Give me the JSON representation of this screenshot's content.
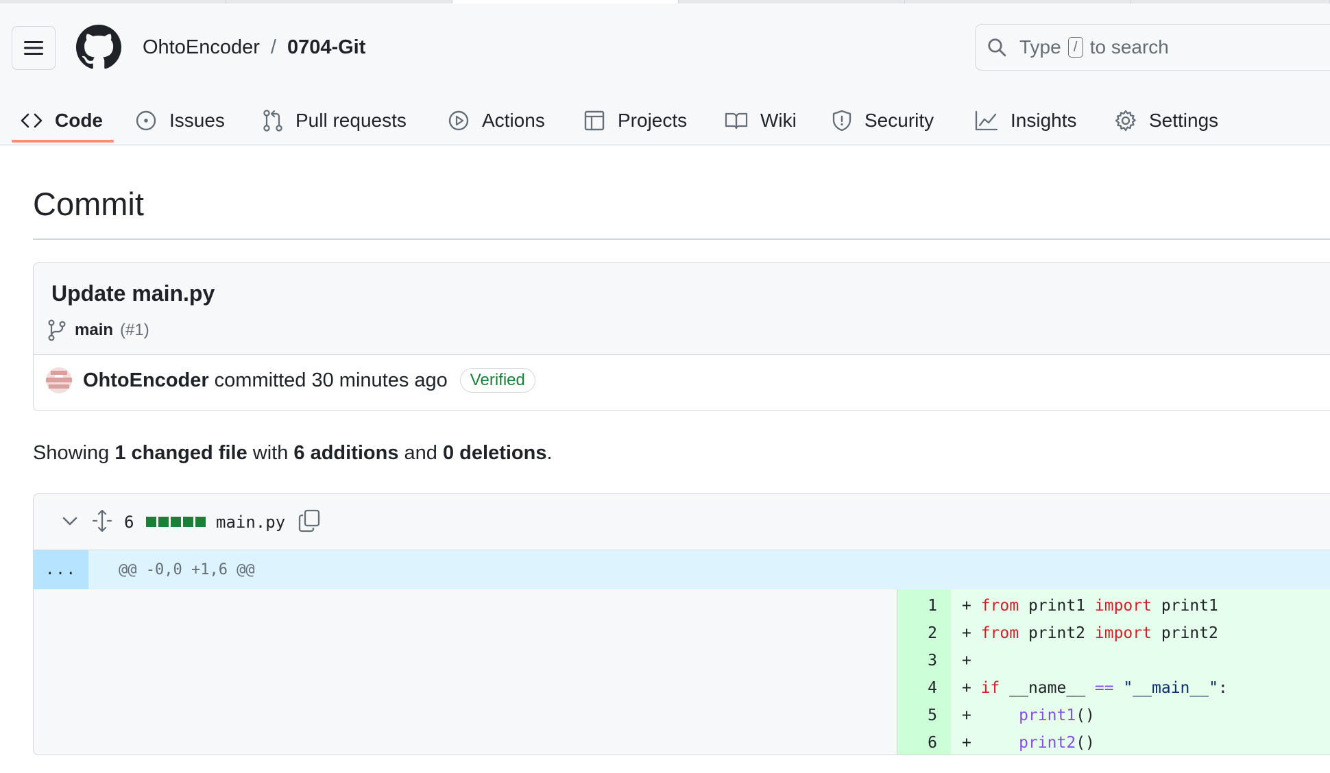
{
  "header": {
    "owner": "OhtoEncoder",
    "separator": "/",
    "repo": "0704-Git",
    "search": {
      "prefix": "Type",
      "key": "/",
      "suffix": "to search"
    }
  },
  "nav": {
    "tabs": [
      {
        "label": "Code",
        "icon": "code-icon",
        "active": true
      },
      {
        "label": "Issues",
        "icon": "issue-icon",
        "active": false
      },
      {
        "label": "Pull requests",
        "icon": "pull-request-icon",
        "active": false
      },
      {
        "label": "Actions",
        "icon": "play-icon",
        "active": false
      },
      {
        "label": "Projects",
        "icon": "table-icon",
        "active": false
      },
      {
        "label": "Wiki",
        "icon": "book-icon",
        "active": false
      },
      {
        "label": "Security",
        "icon": "shield-icon",
        "active": false
      },
      {
        "label": "Insights",
        "icon": "graph-icon",
        "active": false
      },
      {
        "label": "Settings",
        "icon": "gear-icon",
        "active": false
      }
    ]
  },
  "page": {
    "title": "Commit"
  },
  "commit": {
    "message": "Update main.py",
    "branch": "main",
    "pr": "(#1)",
    "author": "OhtoEncoder",
    "action": "committed 30 minutes ago",
    "badge": "Verified"
  },
  "summary": {
    "showing": "Showing",
    "files": "1 changed file",
    "with": "with",
    "additions": "6 additions",
    "and": "and",
    "deletions": "0 deletions",
    "end": "."
  },
  "diff": {
    "file": "main.py",
    "count": "6",
    "expand_label": "...",
    "hunk": "@@ -0,0 +1,6 @@",
    "lines": [
      {
        "num": "1",
        "text": "+ from print1 import print1"
      },
      {
        "num": "2",
        "text": "+ from print2 import print2"
      },
      {
        "num": "3",
        "text": "+"
      },
      {
        "num": "4",
        "text": "+ if __name__ == \"__main__\":"
      },
      {
        "num": "5",
        "text": "+     print1()"
      },
      {
        "num": "6",
        "text": "+     print2()"
      }
    ]
  },
  "colors": {
    "accent_underline": "#fd8c73",
    "verified": "#1a7f37",
    "added_bg": "#e6ffec",
    "added_num_bg": "#ccffd8",
    "hunk_bg": "#ddf4ff",
    "keyword": "#cf222e",
    "function": "#8250df"
  }
}
